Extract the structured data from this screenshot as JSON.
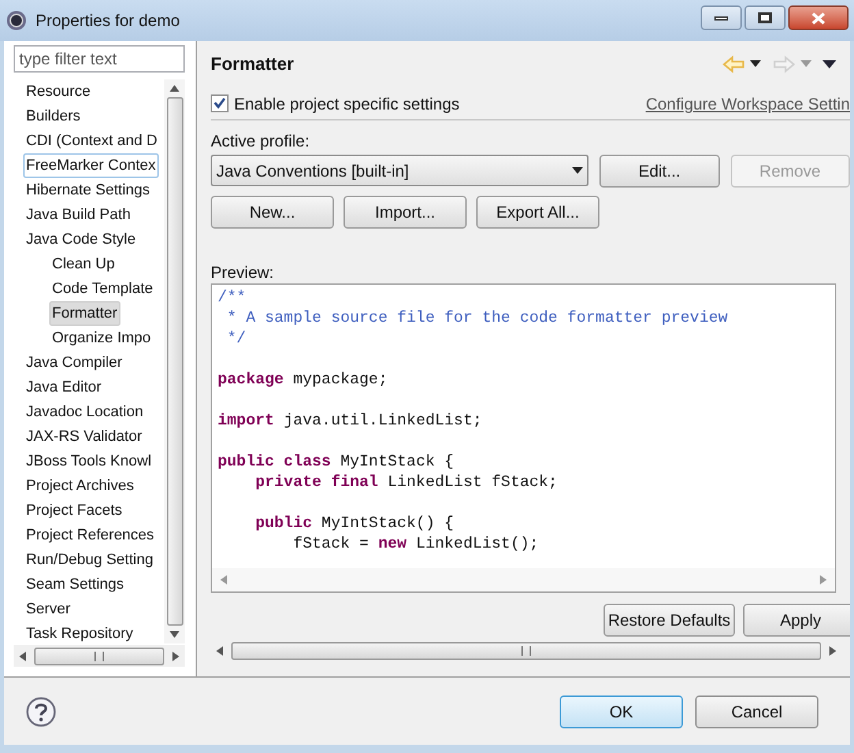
{
  "window": {
    "title": "Properties for demo"
  },
  "filter": {
    "placeholder": "type filter text"
  },
  "sidebar": {
    "items": [
      {
        "label": "Resource",
        "selected": false,
        "focused": false
      },
      {
        "label": "Builders",
        "selected": false,
        "focused": false
      },
      {
        "label": "CDI (Context and D",
        "selected": false,
        "focused": false
      },
      {
        "label": "FreeMarker Contex",
        "selected": false,
        "focused": true
      },
      {
        "label": "Hibernate Settings",
        "selected": false,
        "focused": false
      },
      {
        "label": "Java Build Path",
        "selected": false,
        "focused": false
      },
      {
        "label": "Java Code Style",
        "selected": false,
        "focused": false,
        "children": [
          {
            "label": "Clean Up",
            "selected": false,
            "focused": false
          },
          {
            "label": "Code Template",
            "selected": false,
            "focused": false
          },
          {
            "label": "Formatter",
            "selected": true,
            "focused": false
          },
          {
            "label": "Organize Impo",
            "selected": false,
            "focused": false
          }
        ]
      },
      {
        "label": "Java Compiler",
        "selected": false,
        "focused": false
      },
      {
        "label": "Java Editor",
        "selected": false,
        "focused": false
      },
      {
        "label": "Javadoc Location",
        "selected": false,
        "focused": false
      },
      {
        "label": "JAX-RS Validator",
        "selected": false,
        "focused": false
      },
      {
        "label": "JBoss Tools Knowl",
        "selected": false,
        "focused": false
      },
      {
        "label": "Project Archives",
        "selected": false,
        "focused": false
      },
      {
        "label": "Project Facets",
        "selected": false,
        "focused": false
      },
      {
        "label": "Project References",
        "selected": false,
        "focused": false
      },
      {
        "label": "Run/Debug Setting",
        "selected": false,
        "focused": false
      },
      {
        "label": "Seam Settings",
        "selected": false,
        "focused": false
      },
      {
        "label": "Server",
        "selected": false,
        "focused": false
      },
      {
        "label": "Task Repository",
        "selected": false,
        "focused": false
      }
    ]
  },
  "page": {
    "title": "Formatter",
    "nav": [
      {
        "kind": "back",
        "disabled": false
      },
      {
        "kind": "forward",
        "disabled": true
      }
    ],
    "enable": {
      "label": "Enable project specific settings",
      "checked": true
    },
    "configure_link": "Configure Workspace Settin",
    "profile_label": "Active profile:",
    "profile": "Java Conventions [built-in]",
    "profile_buttons": [
      {
        "label": "Edit...",
        "disabled": false
      },
      {
        "label": "Remove",
        "disabled": true
      }
    ],
    "buttons": [
      {
        "label": "New..."
      },
      {
        "label": "Import..."
      },
      {
        "label": "Export All..."
      }
    ],
    "preview_label": "Preview:",
    "code": [
      [
        {
          "kind": "comment",
          "text": "/**"
        }
      ],
      [
        {
          "kind": "comment",
          "text": " * A sample source file for the code formatter preview"
        }
      ],
      [
        {
          "kind": "comment",
          "text": " */"
        }
      ],
      {
        "space_before": true,
        "tokens": [
          {
            "kind": "keyword",
            "text": "package"
          },
          {
            "kind": "text",
            "text": " mypackage;"
          }
        ]
      },
      {
        "space_before": true,
        "tokens": [
          {
            "kind": "keyword",
            "text": "import"
          },
          {
            "kind": "text",
            "text": " java.util.LinkedList;"
          }
        ]
      },
      {
        "space_before": true,
        "tokens": [
          {
            "kind": "keyword",
            "text": "public class"
          },
          {
            "kind": "text",
            "text": " MyIntStack {"
          }
        ]
      },
      [
        {
          "kind": "keyword",
          "text": "    private final"
        },
        {
          "kind": "text",
          "text": " LinkedList fStack;"
        }
      ],
      {
        "space_before": true,
        "tokens": [
          {
            "kind": "keyword",
            "text": "    public"
          },
          {
            "kind": "text",
            "text": " MyIntStack() {"
          }
        ]
      },
      [
        {
          "kind": "text",
          "text": "        fStack = "
        },
        {
          "kind": "keyword",
          "text": "new"
        },
        {
          "kind": "text",
          "text": " LinkedList();"
        }
      ]
    ],
    "page_buttons": [
      {
        "label": "Restore Defaults"
      },
      {
        "label": "Apply"
      }
    ]
  },
  "footer": {
    "buttons": [
      {
        "label": "OK",
        "default": true
      },
      {
        "label": "Cancel",
        "default": false
      }
    ]
  }
}
